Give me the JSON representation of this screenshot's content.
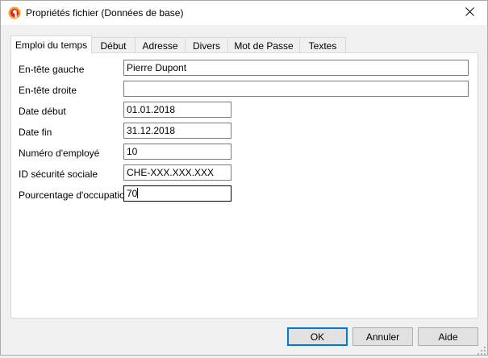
{
  "window": {
    "title": "Propriétés fichier (Données de base)",
    "icon": "banana-app-icon",
    "close_icon": "close-icon"
  },
  "tabs": [
    {
      "label": "Emploi du temps",
      "active": true
    },
    {
      "label": "Début",
      "active": false
    },
    {
      "label": "Adresse",
      "active": false
    },
    {
      "label": "Divers",
      "active": false
    },
    {
      "label": "Mot de Passe",
      "active": false
    },
    {
      "label": "Textes",
      "active": false
    }
  ],
  "fields": [
    {
      "label": "En-tête gauche",
      "value": ""
    },
    {
      "label": "En-tête droite",
      "value": ""
    },
    {
      "label": "Date début",
      "value": "01.01.2018"
    },
    {
      "label": "Date fin",
      "value": "31.12.2018"
    },
    {
      "label": "Numéro d'employé",
      "value": "10"
    },
    {
      "label": "ID sécurité sociale",
      "value": "CHE-XXX.XXX.XXX"
    },
    {
      "label": "Pourcentage d'occupation",
      "value": "70"
    }
  ],
  "header_left_value": "Pierre Dupont",
  "buttons": {
    "ok": "OK",
    "cancel": "Annuler",
    "help": "Aide"
  },
  "colors": {
    "accent": "#0078d7",
    "icon_red": "#e5252a",
    "icon_orange": "#f5a623"
  }
}
